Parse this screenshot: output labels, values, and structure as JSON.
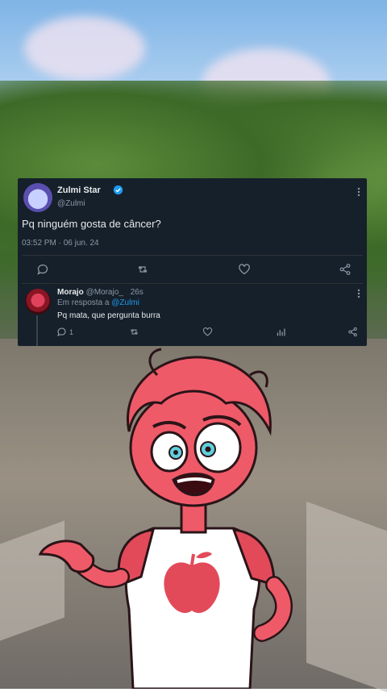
{
  "tweet": {
    "display_name": "Zulmi Star",
    "handle": "@Zulmi",
    "text": "Pq ninguém gosta de câncer?",
    "timestamp": "03:52 PM · 06 jun. 24"
  },
  "reply": {
    "display_name": "Morajo",
    "handle": "@Morajo_",
    "age": "26s",
    "in_reply_prefix": "Em resposta a",
    "in_reply_to": "@Zulmi",
    "text": "Pq mata, que pergunta burra",
    "reply_count": "1"
  },
  "colors": {
    "card_bg": "#15202b",
    "accent": "#1d9bf0",
    "muted": "#8b98a5"
  },
  "icons": [
    "verified-badge-icon",
    "more-icon",
    "reply-icon",
    "retweet-icon",
    "like-icon",
    "share-icon",
    "views-icon"
  ]
}
